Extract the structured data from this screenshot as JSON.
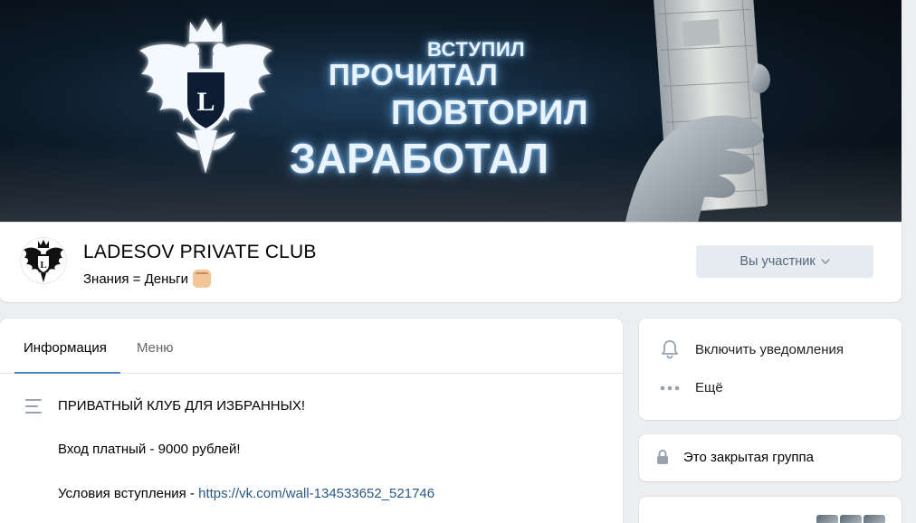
{
  "cover": {
    "line1": "ВСТУПИЛ",
    "line2": "ПРОЧИТАЛ",
    "line3": "ПОВТОРИЛ",
    "line4": "ЗАРАБОТАЛ",
    "emblem_letter": "L",
    "glow_color": "#7cc1ff"
  },
  "group": {
    "name": "LADESOV PRIVATE CLUB",
    "status": "Знания = Деньги",
    "status_emoji": "fist-emoji",
    "member_button": "Вы участник",
    "member_button_icon": "chevron-down-icon"
  },
  "tabs": [
    {
      "label": "Информация",
      "active": true
    },
    {
      "label": "Меню",
      "active": false
    }
  ],
  "info": {
    "line1": "ПРИВАТНЫЙ КЛУБ ДЛЯ ИЗБРАННЫХ!",
    "line2": "Вход платный - 9000 рублей!",
    "line3_prefix": "Условия вступления - ",
    "line3_link": "https://vk.com/wall-134533652_521746"
  },
  "sidebar": {
    "notify": "Включить уведомления",
    "more": "Ещё",
    "closed_group": "Это закрытая группа"
  },
  "colors": {
    "link": "#2a5885",
    "button_bg": "#e5ebf1",
    "tab_accent": "#5181b8",
    "page_bg": "#edeef0"
  }
}
